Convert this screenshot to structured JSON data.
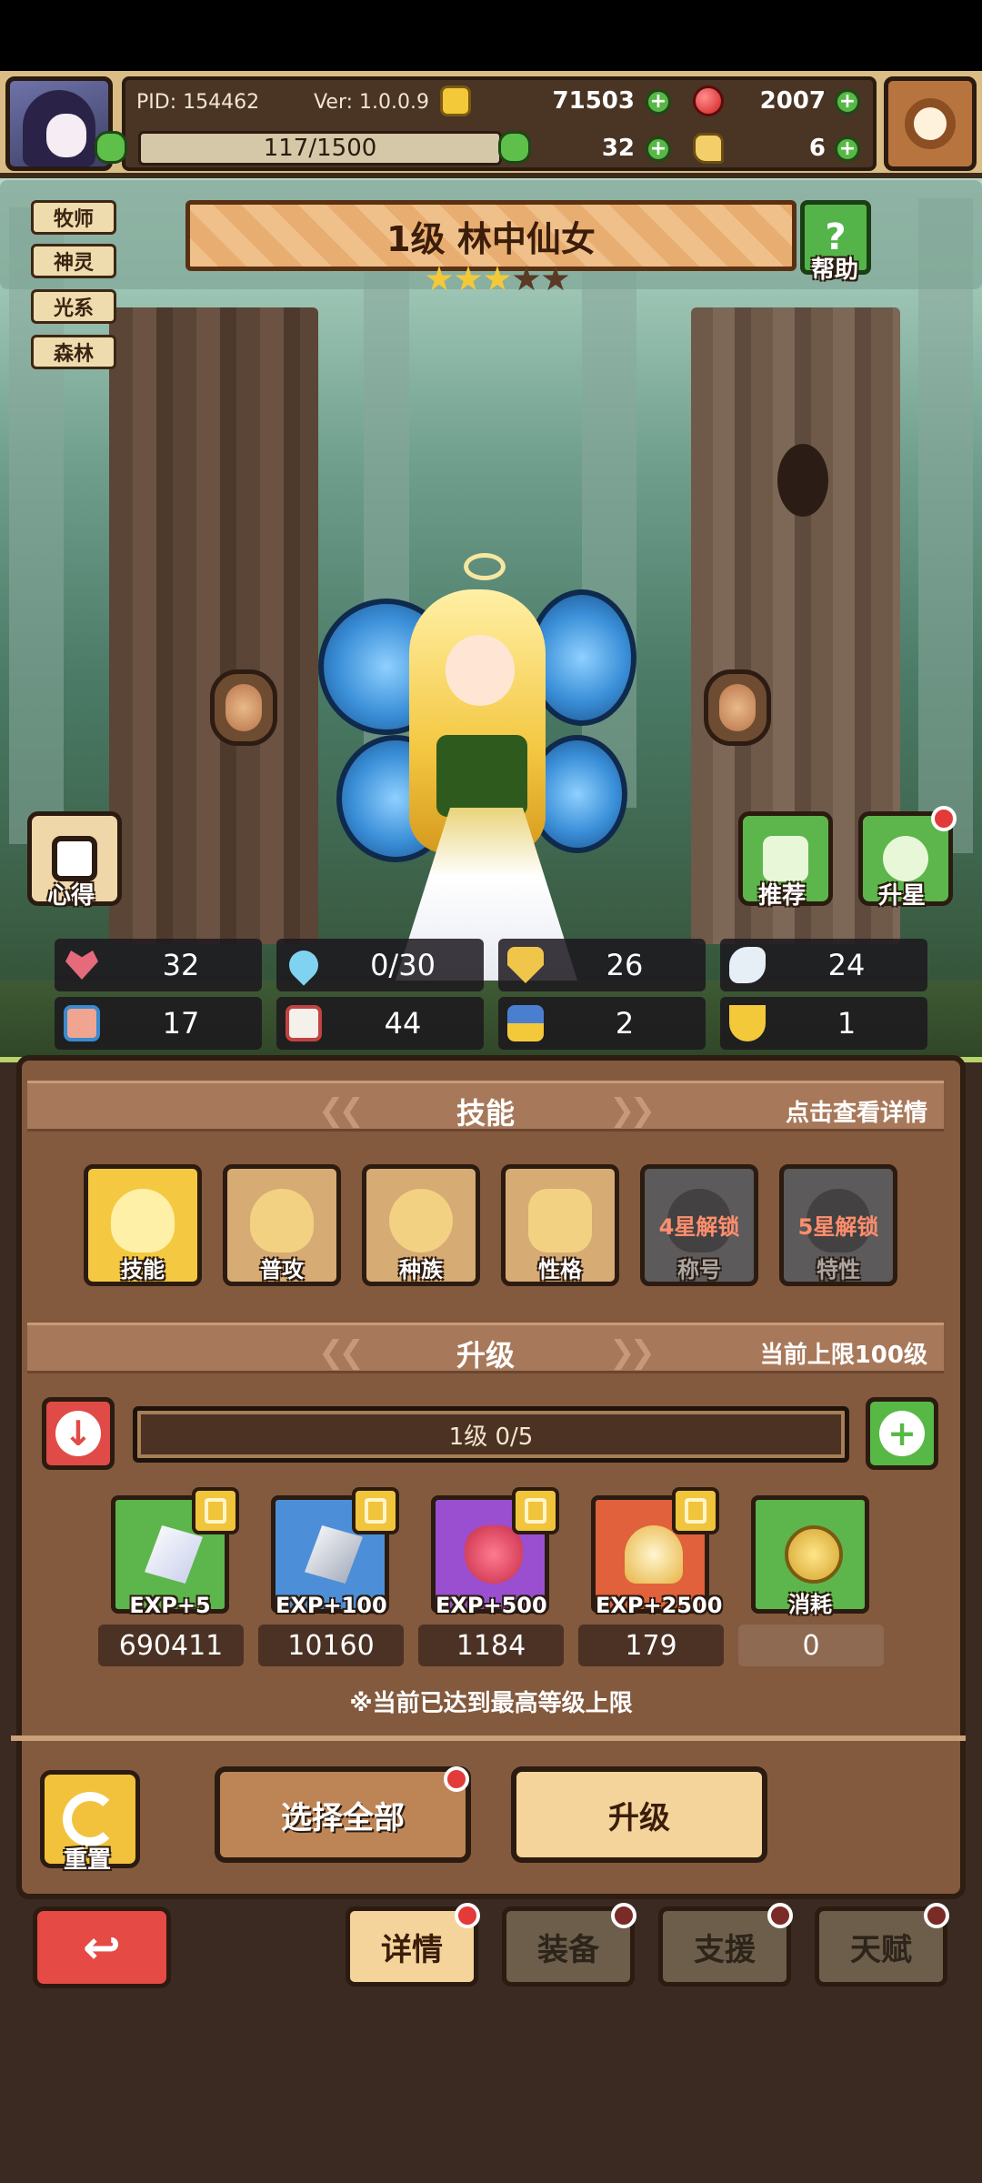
{
  "hud": {
    "pid": "PID: 154462",
    "version": "Ver: 1.0.0.9",
    "coins": "71503",
    "rubies": "2007",
    "stamina": "117/1500",
    "clovers": "32",
    "hands": "6"
  },
  "tags": [
    "牧师",
    "神灵",
    "光系",
    "森林"
  ],
  "hero": {
    "title": "1级  林中仙女",
    "stars_filled": 3,
    "stars_total": 5
  },
  "buttons": {
    "help": "帮助",
    "insight": "心得",
    "recommend": "推荐",
    "star_up": "升星"
  },
  "stats": [
    "32",
    "0/30",
    "26",
    "24",
    "17",
    "44",
    "2",
    "1"
  ],
  "skills_section": {
    "title": "技能",
    "hint": "点击查看详情",
    "items": [
      {
        "label": "技能",
        "lock": ""
      },
      {
        "label": "普攻",
        "lock": ""
      },
      {
        "label": "种族",
        "lock": ""
      },
      {
        "label": "性格",
        "lock": ""
      },
      {
        "label": "称号",
        "lock": "4星解锁"
      },
      {
        "label": "特性",
        "lock": "5星解锁"
      }
    ]
  },
  "upgrade_section": {
    "title": "升级",
    "hint": "当前上限100级",
    "progress": "1级  0/5",
    "items": [
      {
        "label": "EXP+5",
        "count": "690411"
      },
      {
        "label": "EXP+100",
        "count": "10160"
      },
      {
        "label": "EXP+500",
        "count": "1184"
      },
      {
        "label": "EXP+2500",
        "count": "179"
      },
      {
        "label": "消耗",
        "count": "0"
      }
    ],
    "note": "※当前已达到最高等级上限"
  },
  "actions": {
    "reset": "重置",
    "select_all": "选择全部",
    "upgrade": "升级"
  },
  "bottom_tabs": [
    "详情",
    "装备",
    "支援",
    "天赋"
  ],
  "colors": {
    "accent_green": "#58b845",
    "gold": "#f3c93a",
    "alert_red": "#e33a3a"
  }
}
